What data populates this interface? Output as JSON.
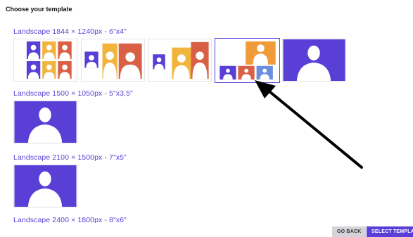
{
  "page": {
    "title": "Choose your template"
  },
  "sections": [
    {
      "label": "Landscape 1844 × 1240px - 6\"x4\""
    },
    {
      "label": "Landscape 1500 × 1050px - 5\"x3,5\""
    },
    {
      "label": "Landscape 2100 × 1500px - 7\"x5\""
    },
    {
      "label": "Landscape 2400 × 1800px - 8\"x6\""
    }
  ],
  "templates": {
    "selected": "multi-photo-1-large-3-small",
    "colors": {
      "purple": "#5a3fd6",
      "yellow": "#f1b53e",
      "red": "#d95f45",
      "orange": "#f09b3a",
      "blue": "#6a8ee0"
    }
  },
  "buttons": {
    "go_back": "GO BACK",
    "select_template": "SELECT TEMPLATE"
  },
  "annotation": {
    "type": "arrow",
    "points_to": "multi-photo-1-large-3-small"
  }
}
